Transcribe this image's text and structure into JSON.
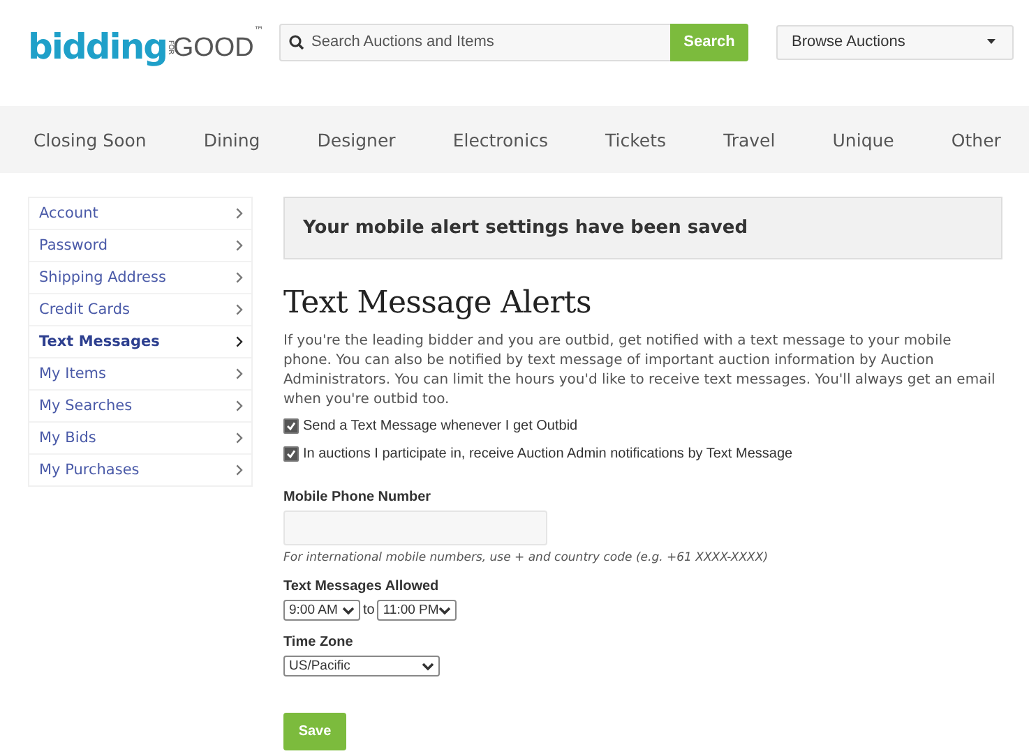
{
  "logo": {
    "word": "bidding",
    "small": "FOR",
    "word2": "GOOD",
    "mark": "™"
  },
  "search": {
    "placeholder": "Search Auctions and Items",
    "button": "Search"
  },
  "browse": {
    "value": "Browse Auctions"
  },
  "categories": [
    "Closing Soon",
    "Dining",
    "Designer",
    "Electronics",
    "Tickets",
    "Travel",
    "Unique",
    "Other"
  ],
  "sidebar": {
    "items": [
      {
        "label": "Account",
        "selected": false
      },
      {
        "label": "Password",
        "selected": false
      },
      {
        "label": "Shipping Address",
        "selected": false
      },
      {
        "label": "Credit Cards",
        "selected": false
      },
      {
        "label": "Text Messages",
        "selected": true
      },
      {
        "label": "My Items",
        "selected": false
      },
      {
        "label": "My Searches",
        "selected": false
      },
      {
        "label": "My Bids",
        "selected": false
      },
      {
        "label": "My Purchases",
        "selected": false
      }
    ]
  },
  "alert": "Your mobile alert settings have been saved",
  "title": "Text Message Alerts",
  "description": "If you're the leading bidder and you are outbid, get notified with a text message to your mobile phone. You can also be notified by text message of important auction information by Auction Administrators. You can limit the hours you'd like to receive text messages. You'll always get an email when you're outbid too.",
  "options": [
    {
      "label": "Send a Text Message whenever I get Outbid",
      "checked": true
    },
    {
      "label": "In auctions I participate in, receive Auction Admin notifications by Text Message",
      "checked": true
    }
  ],
  "phone": {
    "label": "Mobile Phone Number",
    "hint": "For international mobile numbers, use + and country code (e.g. +61 XXXX-XXXX)"
  },
  "allowed": {
    "label": "Text Messages Allowed",
    "from": "9:00 AM",
    "separator": "to",
    "to": "11:00 PM"
  },
  "timezone": {
    "label": "Time Zone",
    "value": "US/Pacific"
  },
  "save": "Save"
}
